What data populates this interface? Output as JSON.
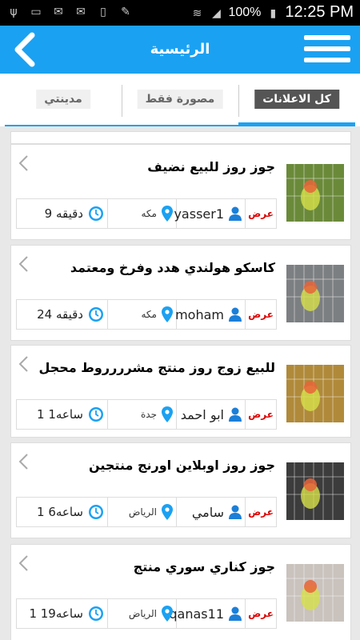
{
  "status_bar": {
    "battery": "100%",
    "time": "12:25 PM"
  },
  "app_bar": {
    "title": "الرئيسية"
  },
  "tabs": [
    {
      "label": "كل الاعلانات",
      "active": true
    },
    {
      "label": "مصورة فقط",
      "active": false
    },
    {
      "label": "مدينتي",
      "active": false
    }
  ],
  "ads": [
    {
      "title": "جوز روز للبيع نضيف",
      "view_label": "عرض",
      "user": "yasser1",
      "city": "مكه",
      "time": "9 دقيقه",
      "thumb_color": "#6a8a3a"
    },
    {
      "title": "كاسكو هولندي هدد وفرخ ومعتمد",
      "view_label": "عرض",
      "user": "moham",
      "city": "مكه",
      "time": "24 دقيقه",
      "thumb_color": "#7c7f82"
    },
    {
      "title": "للبيع زوج روز منتج مشرررروط محجل",
      "view_label": "عرض",
      "user": "ابو احمد",
      "city": "جدة",
      "time": "1 ساعه1",
      "thumb_color": "#b08a3a"
    },
    {
      "title": "جوز روز اوبلاين اورنج منتجين",
      "view_label": "عرض",
      "user": "سامي",
      "city": "الرياض",
      "time": "1 ساعه6",
      "thumb_color": "#3c3c3c"
    },
    {
      "title": "جوز كناري سوري منتج",
      "view_label": "عرض",
      "user": "qanas11",
      "city": "الرياض",
      "time": "1 ساعه19",
      "thumb_color": "#c9c2bd"
    }
  ],
  "colors": {
    "accent": "#1ba1f2",
    "view": "#dd0000",
    "user_icon": "#1b7fd8",
    "pin_icon": "#1ba1f2",
    "clock_icon": "#1ba1f2"
  }
}
